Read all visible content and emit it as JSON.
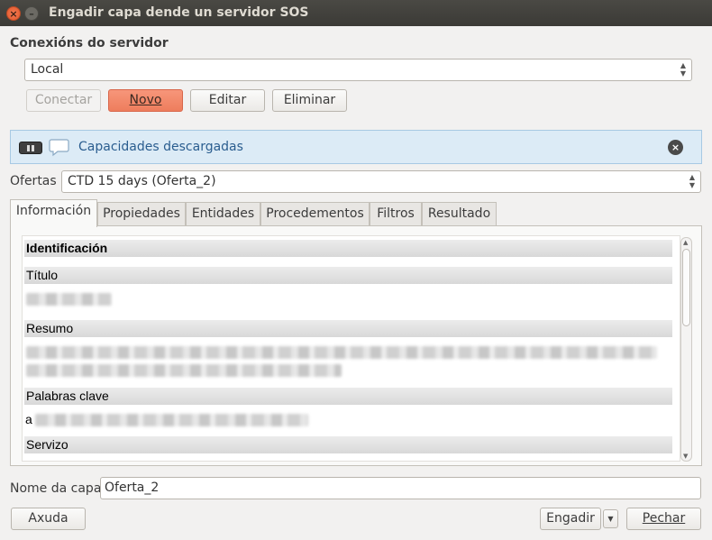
{
  "window": {
    "title": "Engadir capa dende un servidor SOS",
    "close_glyph": "×",
    "minimize_glyph": "–"
  },
  "connections": {
    "group_title": "Conexións do servidor",
    "selected": "Local",
    "buttons": {
      "connect": "Conectar",
      "new": "Novo",
      "edit": "Editar",
      "remove": "Eliminar"
    }
  },
  "message_bar": {
    "text": "Capacidades descargadas",
    "close_glyph": "×",
    "icons": [
      "pause-icon",
      "speech-bubble-icon",
      "close-icon"
    ]
  },
  "offerings": {
    "label": "Ofertas",
    "selected": "CTD 15 days (Oferta_2)"
  },
  "tabs": [
    {
      "label": "Información",
      "selected": true
    },
    {
      "label": "Propiedades",
      "selected": false
    },
    {
      "label": "Entidades",
      "selected": false
    },
    {
      "label": "Procedementos",
      "selected": false
    },
    {
      "label": "Filtros",
      "selected": false
    },
    {
      "label": "Resultado",
      "selected": false
    }
  ],
  "info": {
    "identification": "Identificación",
    "title": "Título",
    "abstract": "Resumo",
    "keywords": "Palabras clave",
    "keywords_prefix": "a",
    "service": "Servizo"
  },
  "layer_name": {
    "label": "Nome da capa",
    "value": "Oferta_2"
  },
  "footer": {
    "help": "Axuda",
    "add": "Engadir",
    "close": "Pechar"
  },
  "colors": {
    "titlebar": "#3b3a36",
    "accent_button": "#ee7d5d",
    "message_bar_bg": "#dcebf6",
    "message_text": "#2a5d8f"
  }
}
